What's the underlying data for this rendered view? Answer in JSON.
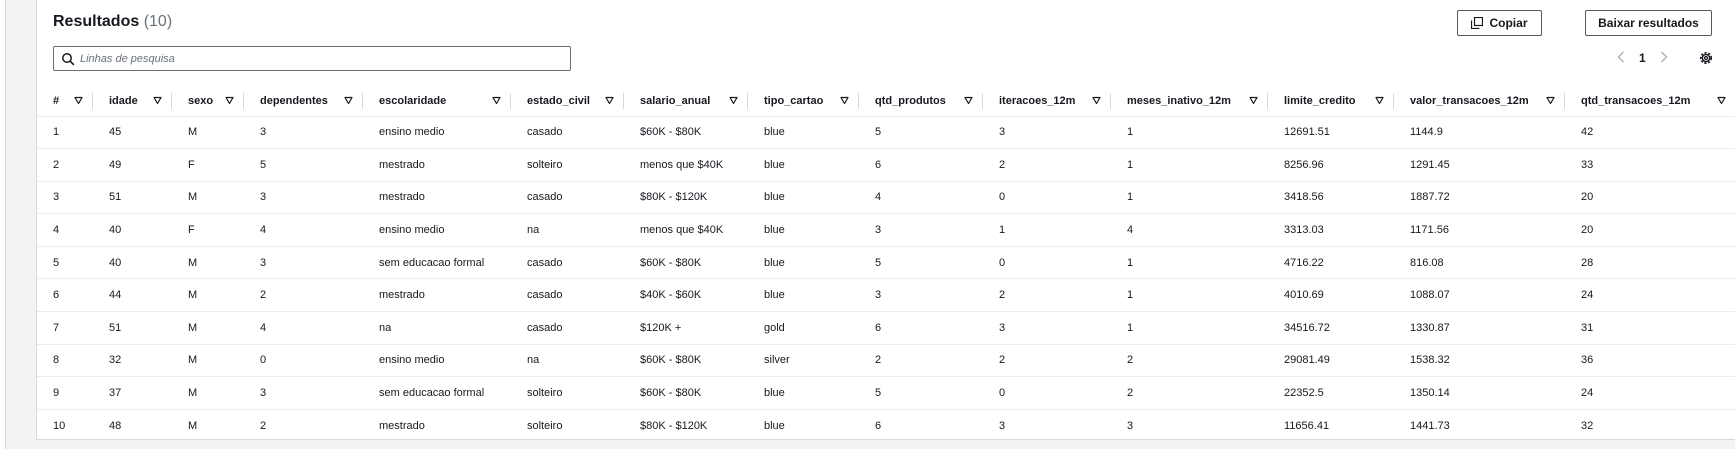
{
  "header": {
    "title": "Resultados",
    "count": "(10)",
    "copy_label": "Copiar",
    "download_label": "Baixar resultados"
  },
  "search": {
    "placeholder": "Linhas de pesquisa"
  },
  "pagination": {
    "current_page": "1",
    "prev_icon": "chevron-left-icon",
    "next_icon": "chevron-right-icon"
  },
  "table": {
    "columns": [
      "#",
      "idade",
      "sexo",
      "dependentes",
      "escolaridade",
      "estado_civil",
      "salario_anual",
      "tipo_cartao",
      "qtd_produtos",
      "iteracoes_12m",
      "meses_inativo_12m",
      "limite_credito",
      "valor_transacoes_12m",
      "qtd_transacoes_12m"
    ],
    "rows": [
      [
        "1",
        "45",
        "M",
        "3",
        "ensino medio",
        "casado",
        "$60K - $80K",
        "blue",
        "5",
        "3",
        "1",
        "12691.51",
        "1144.9",
        "42"
      ],
      [
        "2",
        "49",
        "F",
        "5",
        "mestrado",
        "solteiro",
        "menos que $40K",
        "blue",
        "6",
        "2",
        "1",
        "8256.96",
        "1291.45",
        "33"
      ],
      [
        "3",
        "51",
        "M",
        "3",
        "mestrado",
        "casado",
        "$80K - $120K",
        "blue",
        "4",
        "0",
        "1",
        "3418.56",
        "1887.72",
        "20"
      ],
      [
        "4",
        "40",
        "F",
        "4",
        "ensino medio",
        "na",
        "menos que $40K",
        "blue",
        "3",
        "1",
        "4",
        "3313.03",
        "1171.56",
        "20"
      ],
      [
        "5",
        "40",
        "M",
        "3",
        "sem educacao formal",
        "casado",
        "$60K - $80K",
        "blue",
        "5",
        "0",
        "1",
        "4716.22",
        "816.08",
        "28"
      ],
      [
        "6",
        "44",
        "M",
        "2",
        "mestrado",
        "casado",
        "$40K - $60K",
        "blue",
        "3",
        "2",
        "1",
        "4010.69",
        "1088.07",
        "24"
      ],
      [
        "7",
        "51",
        "M",
        "4",
        "na",
        "casado",
        "$120K +",
        "gold",
        "6",
        "3",
        "1",
        "34516.72",
        "1330.87",
        "31"
      ],
      [
        "8",
        "32",
        "M",
        "0",
        "ensino medio",
        "na",
        "$60K - $80K",
        "silver",
        "2",
        "2",
        "2",
        "29081.49",
        "1538.32",
        "36"
      ],
      [
        "9",
        "37",
        "M",
        "3",
        "sem educacao formal",
        "solteiro",
        "$60K - $80K",
        "blue",
        "5",
        "0",
        "2",
        "22352.5",
        "1350.14",
        "24"
      ],
      [
        "10",
        "48",
        "M",
        "2",
        "mestrado",
        "solteiro",
        "$80K - $120K",
        "blue",
        "6",
        "3",
        "3",
        "11656.41",
        "1441.73",
        "32"
      ]
    ]
  },
  "colors": {
    "text": "#16191f",
    "muted": "#687078",
    "border": "#eaeded",
    "background": "#f2f3f3"
  }
}
